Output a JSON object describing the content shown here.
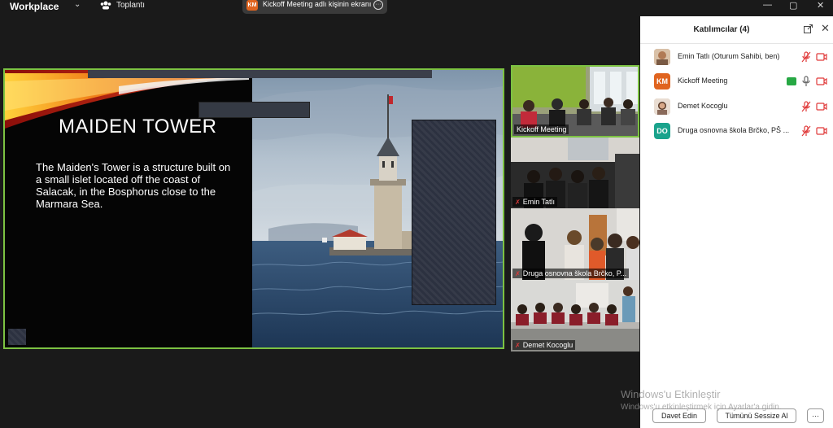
{
  "topbar": {
    "brand": "Workplace",
    "meeting_menu": "Toplantı",
    "share_avatar": "KM",
    "share_text": "Kickoff Meeting adlı kişinin ekranı",
    "more": "···",
    "minimize": "—",
    "maximize": "▢",
    "close": "✕"
  },
  "slide": {
    "title": "MAIDEN TOWER",
    "body": "The Maiden's Tower is a structure built on a small islet located off the coast of Salacak, in the Bosphorus close to the Marmara Sea."
  },
  "video_tiles": [
    {
      "label": "Kickoff Meeting",
      "muted": false
    },
    {
      "label": "Emin Tatlı",
      "muted": true
    },
    {
      "label": "Druga osnovna škola Brčko, P...",
      "muted": true
    },
    {
      "label": "Demet Kocoglu",
      "muted": true
    }
  ],
  "participants_panel": {
    "title": "Katılımcılar (4)",
    "participants": [
      {
        "initials": "",
        "name": "Emin Tatlı (Oturum Sahibi, ben)",
        "avatar_color": "#c9a58a",
        "mic": "muted",
        "sharing": false
      },
      {
        "initials": "KM",
        "name": "Kickoff Meeting",
        "avatar_color": "#e0641f",
        "mic": "on",
        "sharing": true
      },
      {
        "initials": "",
        "name": "Demet Kocoglu",
        "avatar_color": "#d9c3b5",
        "mic": "muted",
        "sharing": false
      },
      {
        "initials": "DO",
        "name": "Druga osnovna škola Brčko, PŠ ...",
        "avatar_color": "#1aa38c",
        "mic": "muted",
        "sharing": false
      }
    ],
    "invite_button": "Davet Edin",
    "mute_all_button": "Tümünü Sessize Al",
    "more_button": "···"
  },
  "watermark": {
    "line1": "Windows'u Etkinleştir",
    "line2": "Windows'u etkinleştirmek için Ayarlar'a gidin."
  },
  "colors": {
    "active_border": "#7cc242",
    "muted": "#e03a3a",
    "share_green": "#27a844"
  }
}
